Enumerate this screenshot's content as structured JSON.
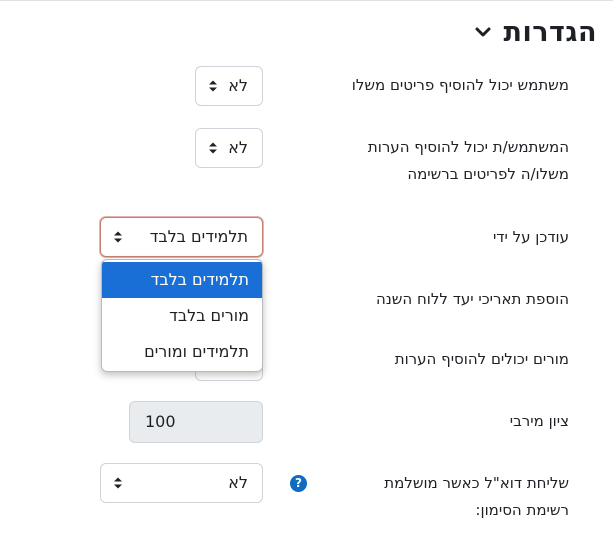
{
  "section": {
    "title": "הגדרות",
    "toggle_icon": "chevron-down-icon"
  },
  "fields": [
    {
      "label": "משתמש יכול להוסיף פריטים משלו",
      "value": "לא"
    },
    {
      "label_lines": [
        "המשתמש/ת יכול להוסיף הערות",
        "משלו/ה לפריטים ברשימה"
      ],
      "value": "לא"
    },
    {
      "label": "עודכן על ידי",
      "value": "תלמידים בלבד"
    },
    {
      "label": "הוספת תאריכי יעד ללוח השנה"
    },
    {
      "label": "מורים יכולים להוסיף הערות"
    },
    {
      "label": "ציון מירבי",
      "value": "100"
    },
    {
      "label_lines": [
        "שליחת דוא\"ל כאשר מושלמת",
        "רשימת הסימון:"
      ],
      "value": "לא",
      "help_icon": "question-circle-icon"
    }
  ],
  "dropdown": {
    "options": [
      "תלמידים בלבד",
      "מורים בלבד",
      "תלמידים ומורים"
    ],
    "selected_index": 0
  },
  "colors": {
    "accent": "#1a6fd6",
    "help": "#0f6cbf",
    "focus_border": "#c47f70"
  }
}
